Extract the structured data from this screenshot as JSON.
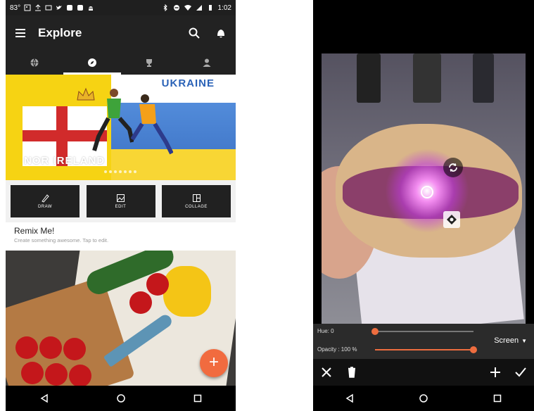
{
  "left": {
    "status": {
      "left_text": "83°",
      "time": "1:02"
    },
    "appbar": {
      "title": "Explore"
    },
    "banner": {
      "country_a": "UKRAINE",
      "country_b": "NOR IRELAND"
    },
    "tools": [
      {
        "label": "DRAW",
        "icon": "brush-icon"
      },
      {
        "label": "EDIT",
        "icon": "image-edit-icon"
      },
      {
        "label": "COLLAGE",
        "icon": "collage-icon"
      }
    ],
    "remix": {
      "title": "Remix Me!",
      "subtitle": "Create something awesome. Tap to edit."
    },
    "fab": {
      "label": "+"
    },
    "colors": {
      "accent": "#f16b3f",
      "appbar": "#222222"
    }
  },
  "right": {
    "hue": {
      "label": "Hue: 0",
      "value": 0
    },
    "opacity": {
      "label": "Opacity : 100 %",
      "value": 100
    },
    "blend_mode": "Screen",
    "colors": {
      "accent": "#ee6d3f"
    }
  }
}
